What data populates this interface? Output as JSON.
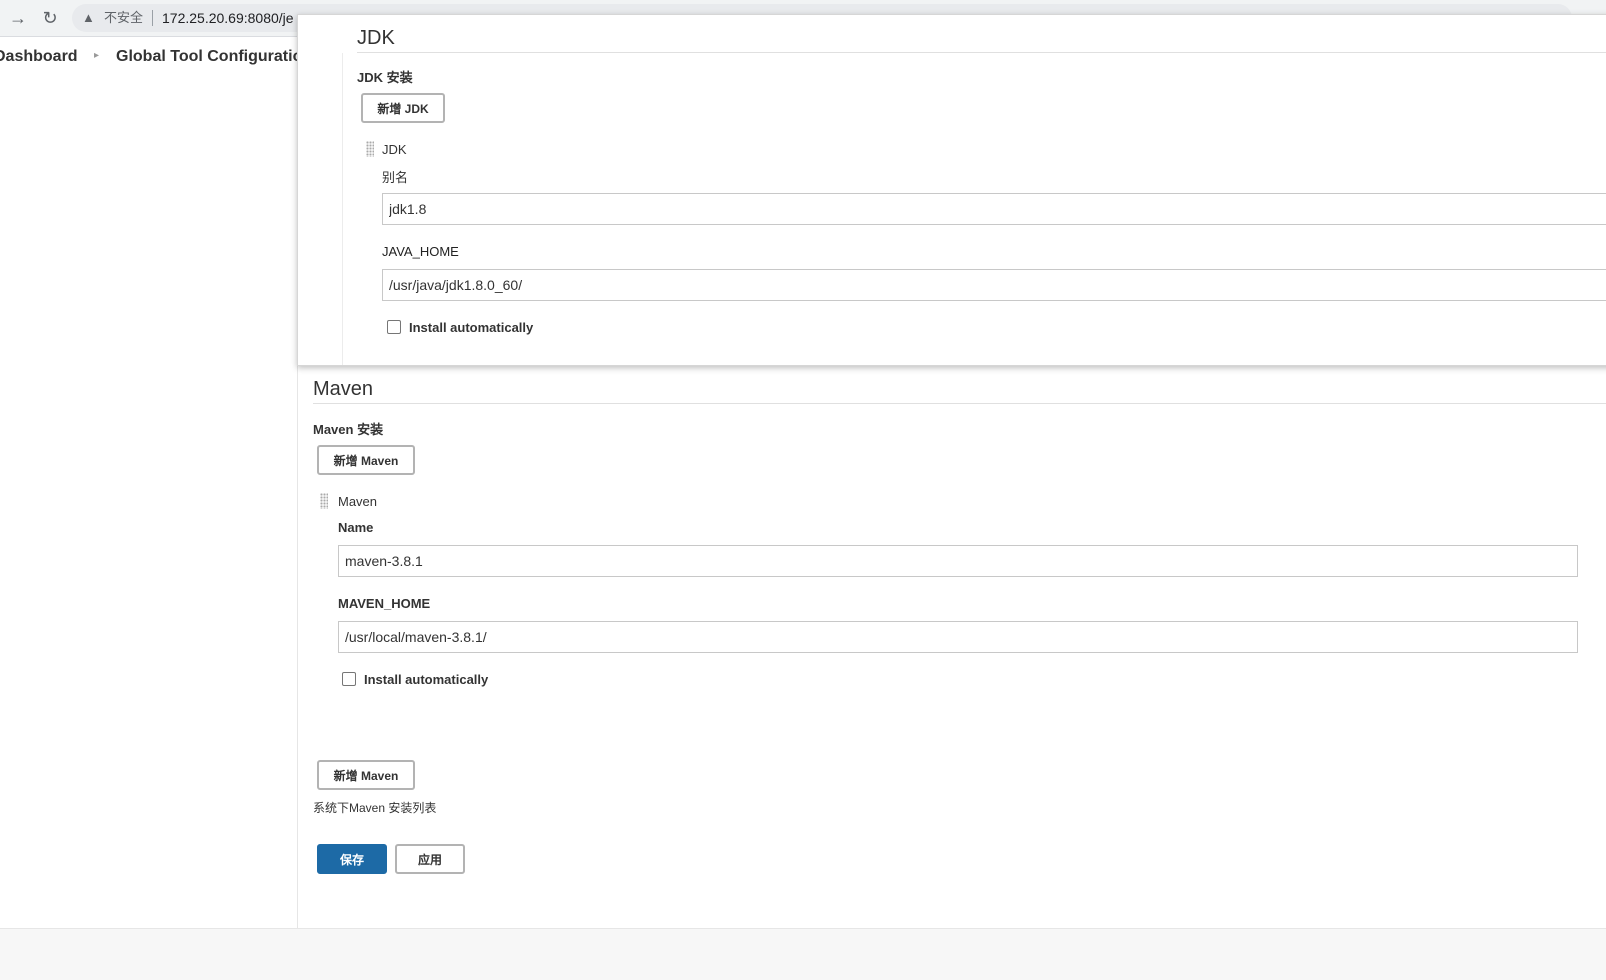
{
  "browser": {
    "security_label": "不安全",
    "url": "172.25.20.69:8080/je"
  },
  "breadcrumb": {
    "dashboard": "Dashboard",
    "current": "Global Tool Configuration"
  },
  "jdk": {
    "title": "JDK",
    "install_label": "JDK 安装",
    "add_button": "新增 JDK",
    "entry_header": "JDK",
    "alias_label": "别名",
    "alias_value": "jdk1.8",
    "home_label": "JAVA_HOME",
    "home_value": "/usr/java/jdk1.8.0_60/",
    "auto_install_label": "Install automatically"
  },
  "maven": {
    "title": "Maven",
    "install_label": "Maven 安装",
    "add_button": "新增 Maven",
    "entry_header": "Maven",
    "name_label": "Name",
    "name_value": "maven-3.8.1",
    "home_label": "MAVEN_HOME",
    "home_value": "/usr/local/maven-3.8.1/",
    "auto_install_label": "Install automatically",
    "add_button_bottom": "新增 Maven",
    "list_hint": "系统下Maven 安装列表"
  },
  "actions": {
    "save": "保存",
    "apply": "应用"
  }
}
